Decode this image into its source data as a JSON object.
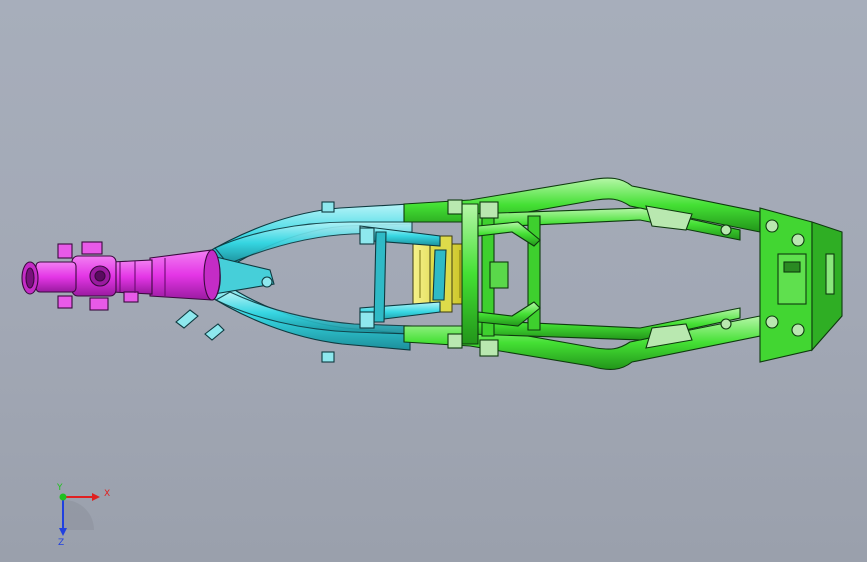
{
  "viewport": {
    "part_colors": {
      "head_tube": "#e436e6",
      "front_frame": "#36d6e2",
      "rear_frame": "#36e23a",
      "bracket": "#e8e23a",
      "hardware": "#b9e8b0",
      "background": "#a4abb8"
    }
  },
  "triad": {
    "x_label": "X",
    "y_label": "Y",
    "z_label": "Z",
    "x_color": "#e02020",
    "y_color": "#20c020",
    "z_color": "#2040e0"
  }
}
